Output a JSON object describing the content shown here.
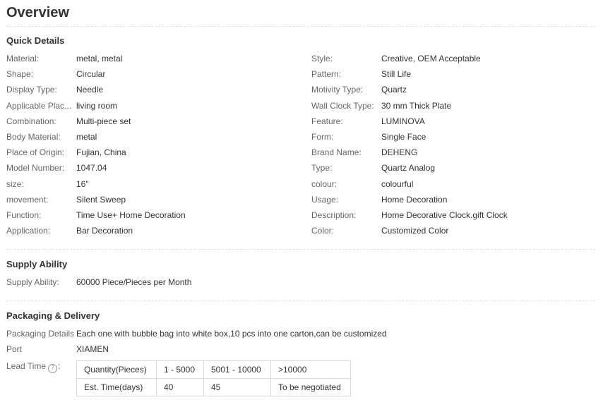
{
  "overview": {
    "title": "Overview"
  },
  "quick_details": {
    "title": "Quick Details",
    "left": [
      {
        "label": "Material:",
        "value": "metal, metal"
      },
      {
        "label": "Shape:",
        "value": "Circular"
      },
      {
        "label": "Display Type:",
        "value": "Needle"
      },
      {
        "label": "Applicable Plac...",
        "value": "living room"
      },
      {
        "label": "Combination:",
        "value": "Multi-piece set"
      },
      {
        "label": "Body Material:",
        "value": "metal"
      },
      {
        "label": "Place of Origin:",
        "value": "Fujian, China"
      },
      {
        "label": "Model Number:",
        "value": "1047.04"
      },
      {
        "label": "size:",
        "value": "16\""
      },
      {
        "label": "movement:",
        "value": "Silent Sweep"
      },
      {
        "label": "Function:",
        "value": "Time Use+ Home Decoration"
      },
      {
        "label": "Application:",
        "value": "Bar Decoration"
      }
    ],
    "right": [
      {
        "label": "Style:",
        "value": "Creative, OEM Acceptable"
      },
      {
        "label": "Pattern:",
        "value": "Still Life"
      },
      {
        "label": "Motivity Type:",
        "value": "Quartz"
      },
      {
        "label": "Wall Clock Type:",
        "value": "30 mm Thick Plate"
      },
      {
        "label": "Feature:",
        "value": "LUMINOVA"
      },
      {
        "label": "Form:",
        "value": "Single Face"
      },
      {
        "label": "Brand Name:",
        "value": "DEHENG"
      },
      {
        "label": "Type:",
        "value": "Quartz Analog"
      },
      {
        "label": "colour:",
        "value": "colourful"
      },
      {
        "label": "Usage:",
        "value": "Home Decoration"
      },
      {
        "label": "Description:",
        "value": "Home Decorative Clock.gift Clock"
      },
      {
        "label": "Color:",
        "value": "Customized Color"
      }
    ]
  },
  "supply_ability": {
    "title": "Supply Ability",
    "label": "Supply Ability:",
    "value": "60000 Piece/Pieces per Month"
  },
  "packaging": {
    "title": "Packaging & Delivery",
    "details_label": "Packaging Details",
    "details_value": "Each one with bubble bag into white box,10 pcs into one carton,can be customized",
    "port_label": "Port",
    "port_value": "XIAMEN",
    "lead_time_label": "Lead Time",
    "lead_time_colon": ":",
    "help_icon": "question-circle-icon",
    "lead_table": {
      "rows": [
        [
          "Quantity(Pieces)",
          "1 - 5000",
          "5001 - 10000",
          ">10000"
        ],
        [
          "Est. Time(days)",
          "40",
          "45",
          "To be negotiated"
        ]
      ]
    }
  }
}
